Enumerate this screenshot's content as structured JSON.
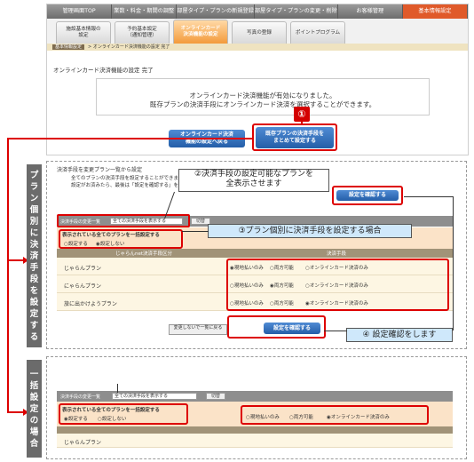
{
  "top_nav": [
    "管理画面TOP",
    "業数・料金・期間の調整",
    "部屋タイプ・プランの新規登録",
    "部屋タイプ・プランの変更・削除",
    "お客様管理",
    "基本情報設定"
  ],
  "sub_tabs": [
    "施設基本情報の\n設定",
    "予約基本設定\n（通知管理）",
    "オンラインカード\n決済機能の設定",
    "写真の登録",
    "ポイントプログラム"
  ],
  "breadcrumb": {
    "home": "基本情報設定",
    "sep": ">",
    "current": "オンラインカード決済機能の設定 完了"
  },
  "page_title": "オンラインカード決済機能の設定 完了",
  "message": {
    "line1": "オンラインカード決済機能が有効になりました。",
    "line2": "既存プランの決済手段にオンラインカード決済を選択することができます。"
  },
  "buttons": {
    "back": "オンラインカード決済\n機能の設定へ戻る",
    "set_all": "既存プランの決済手段を\nまとめて設定する",
    "confirm": "設定を確認する",
    "no_change": "変更しないで一覧に戻る",
    "switch": "切替"
  },
  "badge": "①",
  "side_labels": {
    "per_plan": [
      "プ",
      "ラ",
      "ン",
      "個",
      "別",
      "に",
      "決",
      "済",
      "手",
      "段",
      "を",
      "設",
      "定",
      "す",
      "る"
    ],
    "bulk": [
      "一",
      "括",
      "設",
      "定",
      "の",
      "場",
      "合"
    ]
  },
  "section2": {
    "title": "決済手段を変更プラン一覧から設定",
    "desc": "全てのプランの決済手段を設定することができます。\n設定がお済みたら、最後は「設定を確認する」を押してください。",
    "filter_label": "決済手段の変更一覧",
    "filter_value": "全ての決済手段を表示する",
    "bulk_title": "表示されている全てのプランを一括設定する",
    "bulk_options": [
      "設定する",
      "設定しない"
    ],
    "bulk_selected": 1,
    "table_head": [
      "じゃらんnet決済手段区分",
      "決済手段"
    ],
    "plans": [
      {
        "name": "じゃらんプラン",
        "selected": 0
      },
      {
        "name": "にゃらんプラン",
        "selected": 1
      },
      {
        "name": "旅に出かけようプラン",
        "selected": 2
      }
    ],
    "payment_options": [
      "現地払いのみ",
      "両方可能",
      "オンラインカード決済のみ"
    ]
  },
  "section3": {
    "filter_label": "決済手段の変更一覧",
    "filter_value": "全ての決済手段を表示する",
    "bulk_title": "表示されている全てのプランを一括設定する",
    "bulk_options": [
      "設定する",
      "設定しない"
    ],
    "bulk_selected": 0,
    "all_selected": 2,
    "plan": "じゃらんプラン"
  },
  "callouts": {
    "c2": "②決済手段の設定可能なプランを\n全表示させます",
    "c3": "③プラン個別に決済手段を設定する場合",
    "c4": "④ 設定確認をします"
  },
  "colors": {
    "accent_red": "#dd0000",
    "button_blue": "#2f6bb8",
    "nav_active": "#e05a2a"
  }
}
